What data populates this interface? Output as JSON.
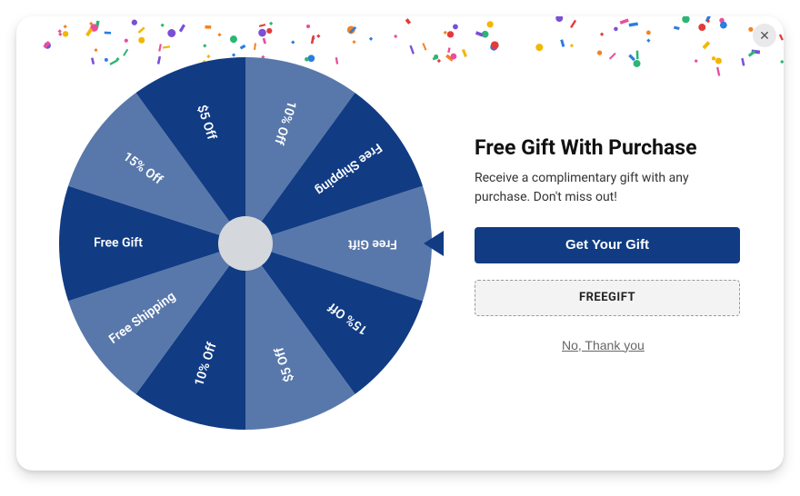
{
  "title": "Free Gift With Purchase",
  "subtitle": "Receive a complimentary gift with any purchase. Don't miss out!",
  "cta_label": "Get Your Gift",
  "coupon_code": "FREEGIFT",
  "decline_label": "No, Thank you",
  "close_label": "✕",
  "wheel": {
    "segments": [
      {
        "label": "Free Gift",
        "color": "#5878ab"
      },
      {
        "label": "15% Off",
        "color": "#113c84"
      },
      {
        "label": "$5 Off",
        "color": "#5878ab"
      },
      {
        "label": "10% Off",
        "color": "#113c84"
      },
      {
        "label": "Free Shipping",
        "color": "#5878ab"
      },
      {
        "label": "Free Gift",
        "color": "#113c84"
      },
      {
        "label": "15% Off",
        "color": "#5878ab"
      },
      {
        "label": "$5 Off",
        "color": "#113c84"
      },
      {
        "label": "10% Off",
        "color": "#5878ab"
      },
      {
        "label": "Free Shipping",
        "color": "#113c84"
      }
    ],
    "pointer_segment_index": 0
  },
  "colors": {
    "accent": "#113c84",
    "wheel_light": "#5878ab",
    "wheel_dark": "#113c84",
    "hub": "#d4d8dc"
  }
}
